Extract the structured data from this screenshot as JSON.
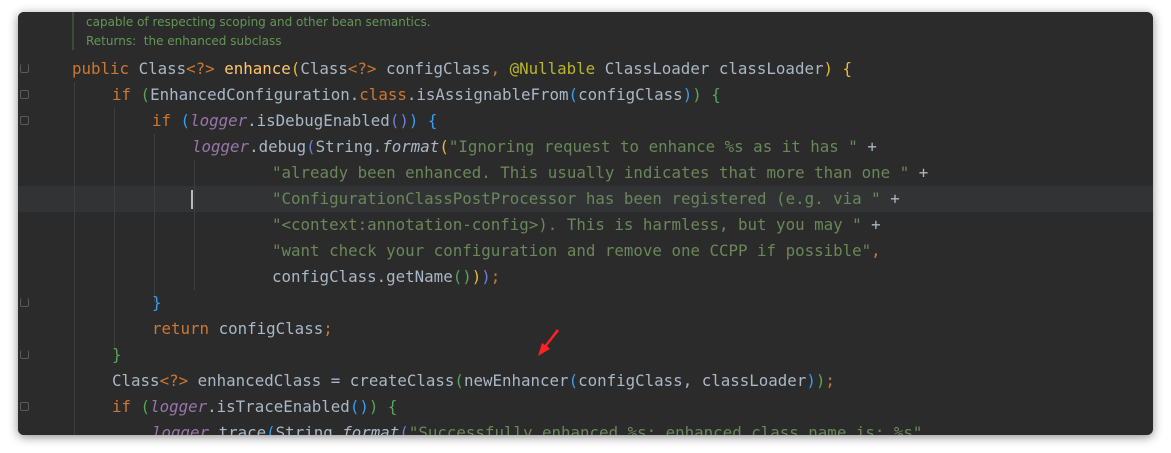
{
  "colors": {
    "background": "#2b2b2b",
    "keyword": "#cc7832",
    "method_declaration": "#ffc66d",
    "annotation": "#bbb529",
    "string": "#6a8759",
    "field": "#9876aa",
    "default_text": "#a9b7c6",
    "doc_comment": "#629755",
    "arrow_annotation": "#ff2020"
  },
  "doc": {
    "line1": "capable of respecting scoping and other bean semantics.",
    "returns_label": "Returns:",
    "returns_text": "the enhanced subclass"
  },
  "code": {
    "l1": {
      "public": "public",
      "class1": "Class",
      "generic1": "<?>",
      "method": "enhance",
      "class2": "Class",
      "generic2": "<?>",
      "param1": "configClass",
      "annotation": "@Nullable",
      "type2": "ClassLoader",
      "param2": "classLoader"
    },
    "l2": {
      "if": "if",
      "expr1": "EnhancedConfiguration.",
      "class_kw": "class",
      "call": ".isAssignableFrom",
      "arg": "configClass"
    },
    "l3": {
      "if": "if",
      "field": "logger",
      "call": ".isDebugEnabled"
    },
    "l4": {
      "field": "logger",
      "call1": ".debug",
      "type": "String.",
      "format": "format",
      "str": "\"Ignoring request to enhance %s as it has \"",
      "plus": "+"
    },
    "l5": {
      "str": "\"already been enhanced. This usually indicates that more than one \"",
      "plus": "+"
    },
    "l6": {
      "str": "\"ConfigurationClassPostProcessor has been registered (e.g. via \"",
      "plus": "+"
    },
    "l7": {
      "str": "\"<context:annotation-config>). This is harmless, but you may \"",
      "plus": "+"
    },
    "l8": {
      "str": "\"want check your configuration and remove one CCPP if possible\"",
      "comma": ","
    },
    "l9": {
      "expr": "configClass.getName",
      "semi": ";"
    },
    "l11": {
      "return": "return",
      "expr": "configClass",
      "semi": ";"
    },
    "l13": {
      "type": "Class",
      "generic": "<?>",
      "expr1": "enhancedClass = createClass",
      "call2": "newEnhancer",
      "args": "configClass, classLoader",
      "semi": ";"
    },
    "l14": {
      "if": "if",
      "field": "logger",
      "call": ".isTraceEnabled"
    },
    "l15": {
      "field": "logger",
      "call1": ".trace",
      "type": "String.",
      "format": "format",
      "str": "\"Successfully enhanced %s; enhanced class name is: %s\""
    }
  }
}
